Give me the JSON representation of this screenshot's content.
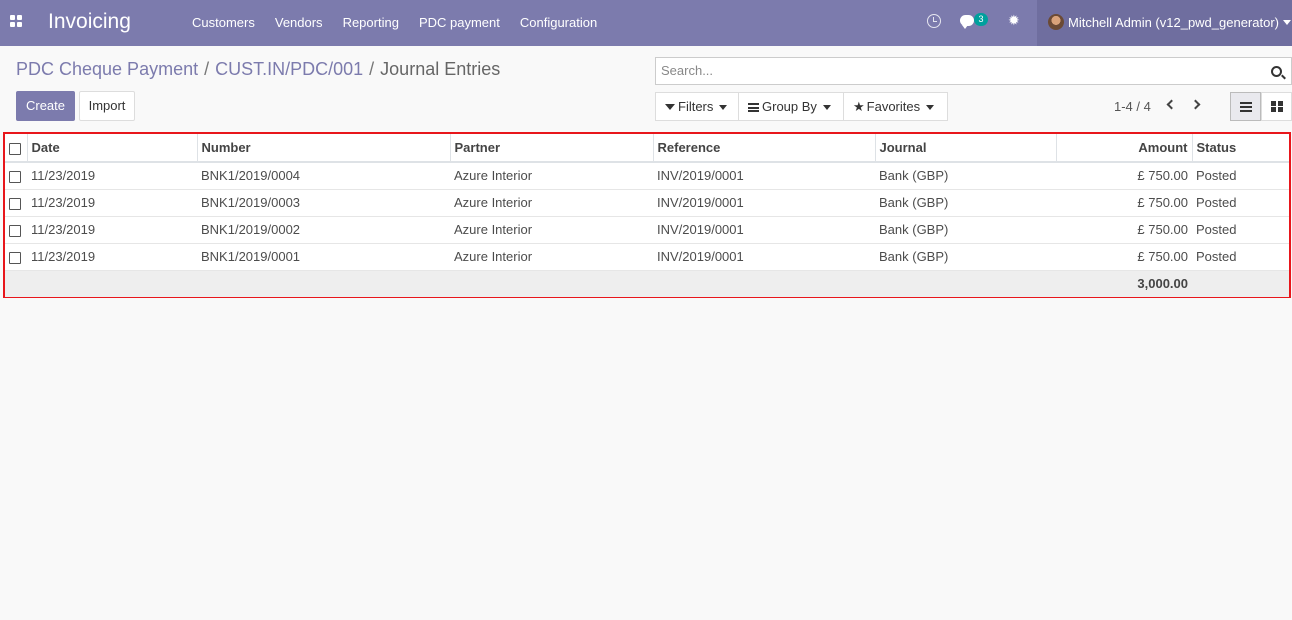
{
  "navbar": {
    "app_title": "Invoicing",
    "menu": [
      "Customers",
      "Vendors",
      "Reporting",
      "PDC payment",
      "Configuration"
    ],
    "messages_count": "3",
    "user_name": "Mitchell Admin (v12_pwd_generator)"
  },
  "breadcrumb": {
    "items": [
      "PDC Cheque Payment",
      "CUST.IN/PDC/001"
    ],
    "separator": "/",
    "current": "Journal Entries"
  },
  "buttons": {
    "create": "Create",
    "import": "Import"
  },
  "search": {
    "placeholder": "Search..."
  },
  "filters": {
    "filters": "Filters",
    "group_by": "Group By",
    "favorites": "Favorites"
  },
  "pager": {
    "text": "1-4 / 4"
  },
  "table": {
    "headers": [
      "Date",
      "Number",
      "Partner",
      "Reference",
      "Journal",
      "Amount",
      "Status"
    ],
    "rows": [
      [
        "11/23/2019",
        "BNK1/2019/0004",
        "Azure Interior",
        "INV/2019/0001",
        "Bank (GBP)",
        "£ 750.00",
        "Posted"
      ],
      [
        "11/23/2019",
        "BNK1/2019/0003",
        "Azure Interior",
        "INV/2019/0001",
        "Bank (GBP)",
        "£ 750.00",
        "Posted"
      ],
      [
        "11/23/2019",
        "BNK1/2019/0002",
        "Azure Interior",
        "INV/2019/0001",
        "Bank (GBP)",
        "£ 750.00",
        "Posted"
      ],
      [
        "11/23/2019",
        "BNK1/2019/0001",
        "Azure Interior",
        "INV/2019/0001",
        "Bank (GBP)",
        "£ 750.00",
        "Posted"
      ]
    ],
    "total_amount": "3,000.00"
  },
  "colors": {
    "brand": "#7c7bad",
    "highlight_border": "#e8161b",
    "badge": "#00a09d"
  }
}
